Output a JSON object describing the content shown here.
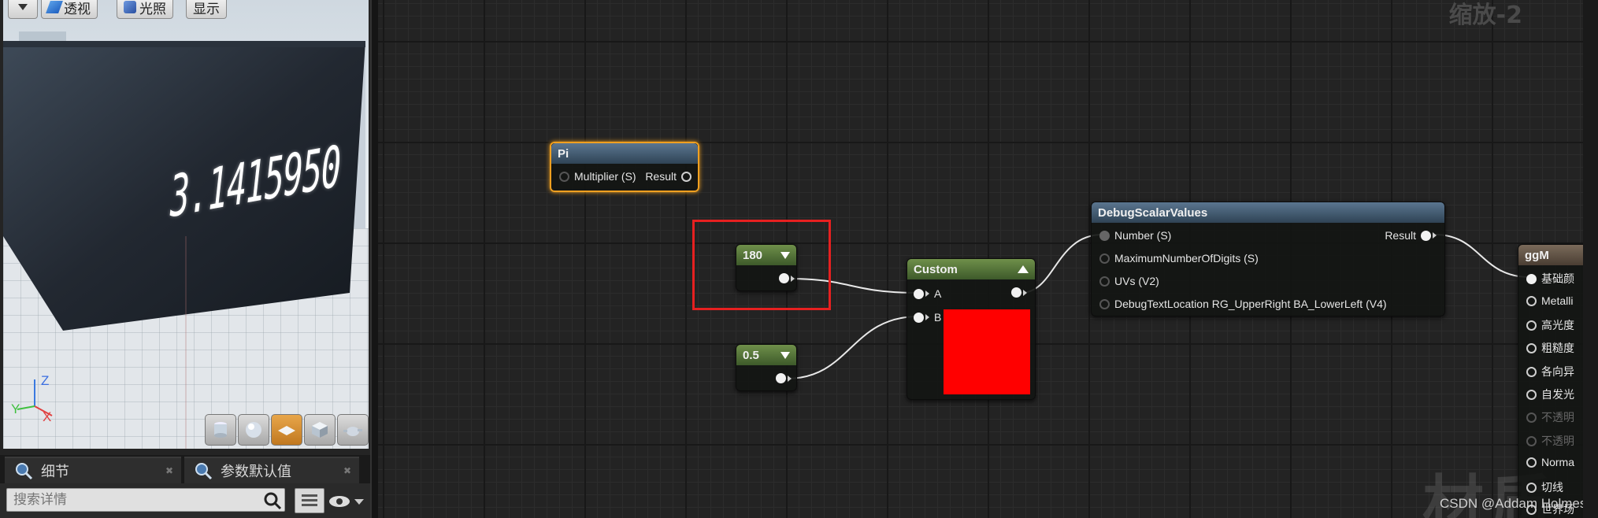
{
  "viewport": {
    "toolbar": {
      "menu_label": "",
      "perspective_label": "透视",
      "lighting_label": "光照",
      "show_label": "显示"
    },
    "cube_value": "3.1415950",
    "axis": {
      "z": "Z",
      "y": "Y",
      "x": "X"
    }
  },
  "panel": {
    "tabs": [
      {
        "label": "细节"
      },
      {
        "label": "参数默认值"
      }
    ],
    "search": {
      "placeholder": "搜索详情"
    }
  },
  "graph": {
    "zoom_label": "缩放-2",
    "watermark": "材质",
    "credit": "CSDN @Addam Holmes",
    "nodes": {
      "pi": {
        "title": "Pi",
        "input": "Multiplier (S)",
        "output": "Result"
      },
      "const_a": {
        "value": "180"
      },
      "const_b": {
        "value": "0.5"
      },
      "custom": {
        "title": "Custom",
        "input_a": "A",
        "input_b": "B",
        "preview_color": "#ff0000"
      },
      "debug": {
        "title": "DebugScalarValues",
        "inputs": [
          "Number (S)",
          "MaximumNumberOfDigits (S)",
          "UVs (V2)",
          "DebugTextLocation RG_UpperRight BA_LowerLeft (V4)"
        ],
        "output": "Result"
      },
      "material": {
        "title": "ggM",
        "inputs": [
          "基础颜",
          "Metalli",
          "高光度",
          "粗糙度",
          "各向异",
          "自发光",
          "不透明",
          "不透明",
          "Norma",
          "切线",
          "世界场"
        ]
      }
    },
    "highlight_color": "#e62020"
  }
}
